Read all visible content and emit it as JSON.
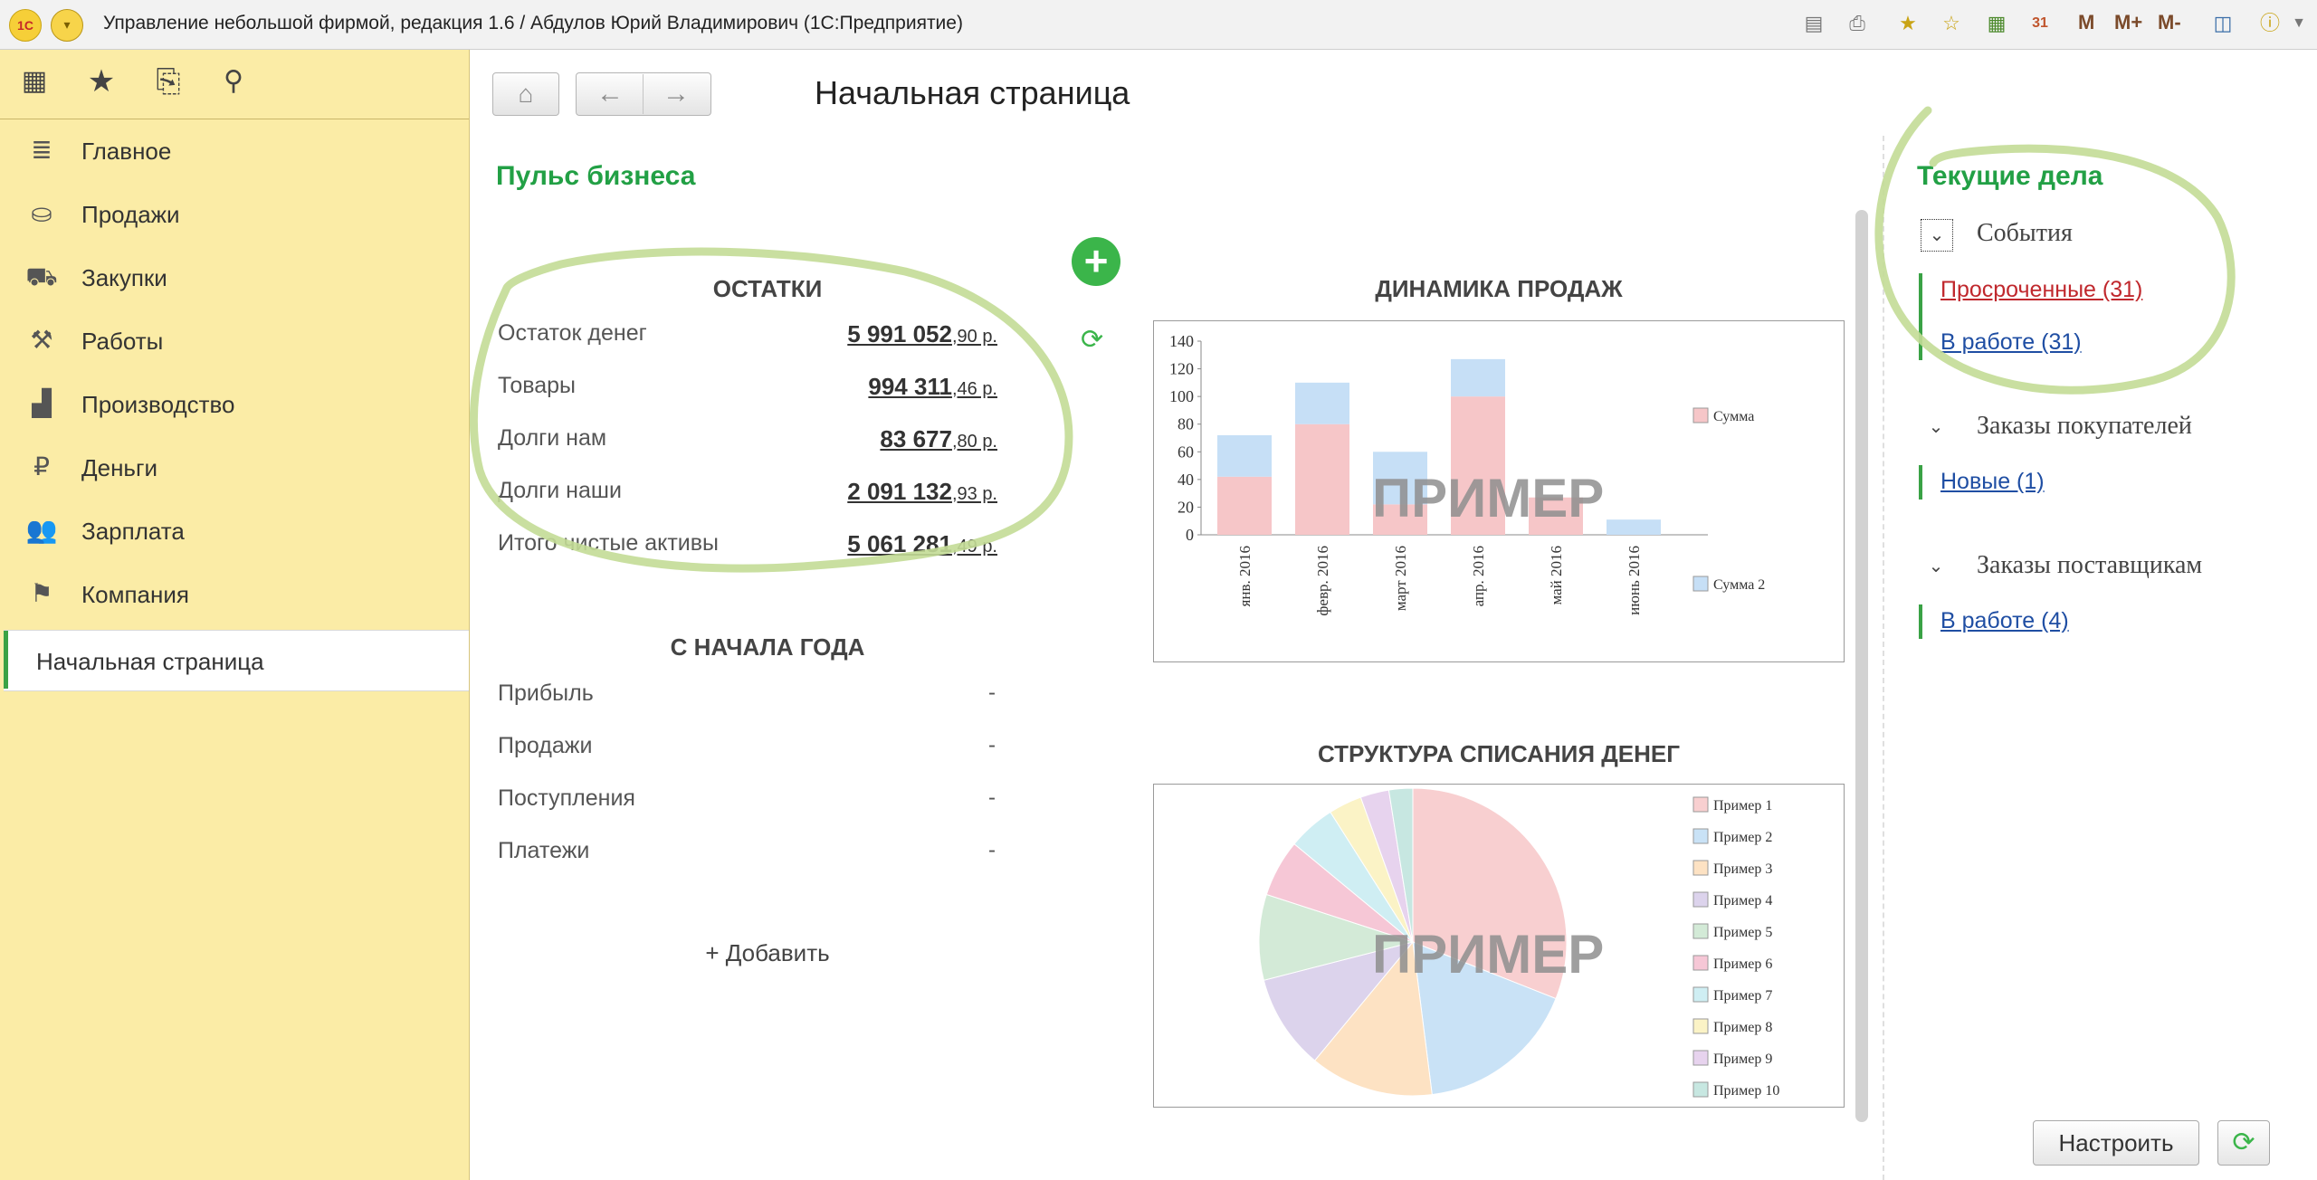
{
  "window": {
    "title": "Управление небольшой фирмой, редакция 1.6 / Абдулов Юрий Владимирович   (1С:Предприятие)",
    "logo_text": "1С",
    "toolbar_m": [
      "M",
      "M+",
      "M-"
    ]
  },
  "sidebar": {
    "items": [
      {
        "label": "Главное",
        "icon": "list-icon"
      },
      {
        "label": "Продажи",
        "icon": "basket-icon"
      },
      {
        "label": "Закупки",
        "icon": "cart-icon"
      },
      {
        "label": "Работы",
        "icon": "tools-icon"
      },
      {
        "label": "Производство",
        "icon": "factory-icon"
      },
      {
        "label": "Деньги",
        "icon": "ruble-icon"
      },
      {
        "label": "Зарплата",
        "icon": "people-icon"
      },
      {
        "label": "Компания",
        "icon": "flag-icon"
      }
    ],
    "home": "Начальная страница"
  },
  "page": {
    "title": "Начальная страница",
    "pulse_title": "Пульс бизнеса"
  },
  "balances": {
    "title": "ОСТАТКИ",
    "rows": [
      {
        "label": "Остаток денег",
        "int": "5 991 052",
        "frac": ",90 р."
      },
      {
        "label": "Товары",
        "int": "994 311",
        "frac": ",46 р."
      },
      {
        "label": "Долги нам",
        "int": "83 677",
        "frac": ",80 р."
      },
      {
        "label": "Долги наши",
        "int": "2 091 132",
        "frac": ",93 р."
      },
      {
        "label": "Итого чистые активы",
        "int": "5 061 281",
        "frac": ",49 р."
      }
    ]
  },
  "ytd": {
    "title": "С НАЧАЛА ГОДА",
    "rows": [
      {
        "label": "Прибыль",
        "value": "-"
      },
      {
        "label": "Продажи",
        "value": "-"
      },
      {
        "label": "Поступления",
        "value": "-"
      },
      {
        "label": "Платежи",
        "value": "-"
      }
    ],
    "add_label": "+ Добавить"
  },
  "sales_chart": {
    "heading": "ДИНАМИКА ПРОДАЖ",
    "watermark": "ПРИМЕР"
  },
  "pie_chart": {
    "heading": "СТРУКТУРА СПИСАНИЯ ДЕНЕГ",
    "watermark": "ПРИМЕР"
  },
  "chart_data": [
    {
      "type": "bar",
      "title": "ДИНАМИКА ПРОДАЖ",
      "categories": [
        "янв. 2016",
        "февр. 2016",
        "март 2016",
        "апр. 2016",
        "май 2016",
        "июнь 2016"
      ],
      "series": [
        {
          "name": "Сумма",
          "values": [
            42,
            80,
            22,
            100,
            27,
            0
          ],
          "color": "#f6c6c8"
        },
        {
          "name": "Сумма 2",
          "values": [
            30,
            30,
            38,
            27,
            0,
            11
          ],
          "color": "#c6dff6"
        }
      ],
      "stacked": true,
      "ylim": [
        0,
        140
      ],
      "yticks": [
        0,
        20,
        40,
        60,
        80,
        100,
        120,
        140
      ],
      "legend": "right"
    },
    {
      "type": "pie",
      "title": "СТРУКТУРА СПИСАНИЯ ДЕНЕГ",
      "labels": [
        "Пример 1",
        "Пример 2",
        "Пример 3",
        "Пример 4",
        "Пример 5",
        "Пример 6",
        "Пример 7",
        "Пример 8",
        "Пример 9",
        "Пример 10"
      ],
      "values": [
        31,
        17,
        13,
        10,
        9,
        6,
        5,
        3.5,
        3,
        2.5
      ],
      "colors": [
        "#f8cfd0",
        "#c9e2f6",
        "#fde2c3",
        "#dcd3ec",
        "#d3ead7",
        "#f6c7d6",
        "#cfeef3",
        "#fbf3c6",
        "#e7d3ee",
        "#c7e7e1"
      ],
      "legend": "right"
    }
  ],
  "right": {
    "title": "Текущие дела",
    "groups": [
      {
        "title": "События",
        "links": [
          {
            "label": "Просроченные (31)",
            "color": "#c0282d"
          },
          {
            "label": "В работе (31)",
            "color": "#1f4ea3"
          }
        ]
      },
      {
        "title": "Заказы покупателей",
        "links": [
          {
            "label": "Новые (1)",
            "color": "#1f4ea3"
          }
        ]
      },
      {
        "title": "Заказы поставщикам",
        "links": [
          {
            "label": "В работе (4)",
            "color": "#1f4ea3"
          }
        ]
      }
    ],
    "configure_label": "Настроить"
  }
}
